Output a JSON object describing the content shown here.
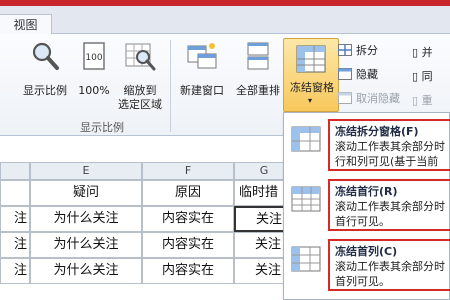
{
  "tabs": {
    "active": "视图"
  },
  "ribbon": {
    "show_ratio": "显示比例",
    "zoom100": "100%",
    "zoom_to_selection_line1": "缩放到",
    "zoom_to_selection_line2": "选定区域",
    "new_window": "新建窗口",
    "arrange_all": "全部重排",
    "freeze_panes": "冻结窗格",
    "split": "拆分",
    "hide": "隐藏",
    "unhide": "取消隐藏",
    "edge_top": "并",
    "edge_mid": "同",
    "edge_bot": "重",
    "group_label": "显示比例"
  },
  "sheet": {
    "col_e": "E",
    "col_f": "F",
    "col_g": "G",
    "headers": [
      "疑问",
      "原因",
      "临时措"
    ],
    "left_cut": "注",
    "rows": [
      [
        "为什么关注",
        "内容实在",
        "关注"
      ],
      [
        "为什么关注",
        "内容实在",
        "关注"
      ],
      [
        "为什么关注",
        "内容实在",
        "关注"
      ]
    ]
  },
  "dropdown": {
    "items": [
      {
        "title": "冻结拆分窗格(F)",
        "desc1": "滚动工作表其余部分时",
        "desc2": "行和列可见(基于当前"
      },
      {
        "title": "冻结首行(R)",
        "desc1": "滚动工作表其余部分时",
        "desc2": "首行可见。"
      },
      {
        "title": "冻结首列(C)",
        "desc1": "滚动工作表其余部分时",
        "desc2": "首列可见。"
      }
    ]
  },
  "colors": {
    "accent_red": "#d42a2a",
    "freeze_highlight": "#f7c85c",
    "ribbon_border": "#b7c3d4"
  }
}
